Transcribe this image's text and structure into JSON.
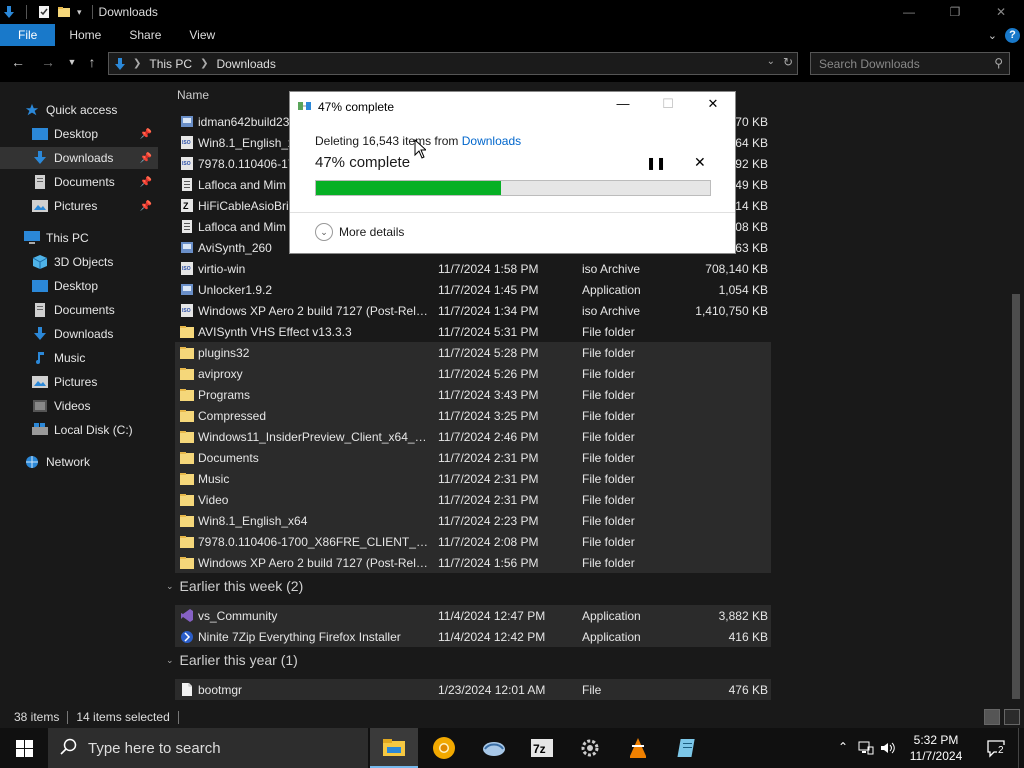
{
  "window": {
    "title": "Downloads",
    "quick_access_icons": [
      "down-arrow-icon",
      "properties-icon",
      "new-folder-icon",
      "customize-dropdown-icon"
    ]
  },
  "ribbon": {
    "tabs": [
      {
        "label": "File",
        "active": true
      },
      {
        "label": "Home"
      },
      {
        "label": "Share"
      },
      {
        "label": "View"
      }
    ],
    "accent": "#1979ca"
  },
  "address": {
    "crumbs": [
      "This PC",
      "Downloads"
    ]
  },
  "search": {
    "placeholder": "Search Downloads"
  },
  "sidebar": {
    "items": [
      {
        "label": "Quick access",
        "icon": "star-icon"
      },
      {
        "label": "Desktop",
        "icon": "desktop-icon",
        "pinned": true
      },
      {
        "label": "Downloads",
        "icon": "download-icon",
        "pinned": true,
        "selected": true
      },
      {
        "label": "Documents",
        "icon": "document-icon",
        "pinned": true
      },
      {
        "label": "Pictures",
        "icon": "pictures-icon",
        "pinned": true
      },
      {
        "label": "This PC",
        "icon": "computer-icon"
      },
      {
        "label": "3D Objects",
        "icon": "cube-icon"
      },
      {
        "label": "Desktop",
        "icon": "desktop-icon"
      },
      {
        "label": "Documents",
        "icon": "document-icon"
      },
      {
        "label": "Downloads",
        "icon": "download-icon"
      },
      {
        "label": "Music",
        "icon": "music-icon"
      },
      {
        "label": "Pictures",
        "icon": "pictures-icon"
      },
      {
        "label": "Videos",
        "icon": "video-icon"
      },
      {
        "label": "Local Disk (C:)",
        "icon": "disk-icon"
      },
      {
        "label": "Network",
        "icon": "network-icon"
      }
    ]
  },
  "list": {
    "column_name": "Name",
    "rows_top": [
      {
        "name": "idman642build23",
        "date": "",
        "type": "",
        "size": "070 KB",
        "icon": "installer-icon"
      },
      {
        "name": "Win8.1_English_x",
        "date": "",
        "type": "",
        "size": "264 KB",
        "icon": "iso-icon"
      },
      {
        "name": "7978.0.110406-17",
        "date": "",
        "type": "",
        "size": "592 KB",
        "icon": "iso-icon"
      },
      {
        "name": "Lafloca and Mim",
        "date": "",
        "type": "",
        "size": "349 KB",
        "icon": "document-icon"
      },
      {
        "name": "HiFiCableAsioBri",
        "date": "",
        "type": "",
        "size": "914 KB",
        "icon": "zip-icon"
      },
      {
        "name": "Lafloca and Mim",
        "date": "",
        "type": "",
        "size": "308 KB",
        "icon": "document-icon"
      },
      {
        "name": "AviSynth_260",
        "date": "",
        "type": "",
        "size": "363 KB",
        "icon": "installer-icon"
      },
      {
        "name": "virtio-win",
        "date": "11/7/2024 1:58 PM",
        "type": "iso Archive",
        "size": "708,140 KB",
        "icon": "iso-icon"
      },
      {
        "name": "Unlocker1.9.2",
        "date": "11/7/2024 1:45 PM",
        "type": "Application",
        "size": "1,054 KB",
        "icon": "installer-icon"
      },
      {
        "name": "Windows XP Aero 2 build 7127 (Post-Rele...",
        "date": "11/7/2024 1:34 PM",
        "type": "iso Archive",
        "size": "1,410,750 KB",
        "icon": "iso-icon"
      },
      {
        "name": "AVISynth VHS Effect v13.3.3",
        "date": "11/7/2024 5:31 PM",
        "type": "File folder",
        "size": "",
        "icon": "folder-icon"
      },
      {
        "name": "plugins32",
        "date": "11/7/2024 5:28 PM",
        "type": "File folder",
        "size": "",
        "icon": "folder-icon",
        "selected": true
      },
      {
        "name": "aviproxy",
        "date": "11/7/2024 5:26 PM",
        "type": "File folder",
        "size": "",
        "icon": "folder-icon",
        "selected": true
      },
      {
        "name": "Programs",
        "date": "11/7/2024 3:43 PM",
        "type": "File folder",
        "size": "",
        "icon": "folder-icon",
        "selected": true
      },
      {
        "name": "Compressed",
        "date": "11/7/2024 3:25 PM",
        "type": "File folder",
        "size": "",
        "icon": "folder-icon",
        "selected": true
      },
      {
        "name": "Windows11_InsiderPreview_Client_x64_e...",
        "date": "11/7/2024 2:46 PM",
        "type": "File folder",
        "size": "",
        "icon": "folder-icon",
        "selected": true
      },
      {
        "name": "Documents",
        "date": "11/7/2024 2:31 PM",
        "type": "File folder",
        "size": "",
        "icon": "folder-icon",
        "selected": true
      },
      {
        "name": "Music",
        "date": "11/7/2024 2:31 PM",
        "type": "File folder",
        "size": "",
        "icon": "folder-icon",
        "selected": true
      },
      {
        "name": "Video",
        "date": "11/7/2024 2:31 PM",
        "type": "File folder",
        "size": "",
        "icon": "folder-icon",
        "selected": true
      },
      {
        "name": "Win8.1_English_x64",
        "date": "11/7/2024 2:23 PM",
        "type": "File folder",
        "size": "",
        "icon": "folder-icon",
        "selected": true
      },
      {
        "name": "7978.0.110406-1700_X86FRE_CLIENT_EN-...",
        "date": "11/7/2024 2:08 PM",
        "type": "File folder",
        "size": "",
        "icon": "folder-icon",
        "selected": true
      },
      {
        "name": "Windows XP Aero 2 build 7127 (Post-Rele...",
        "date": "11/7/2024 1:56 PM",
        "type": "File folder",
        "size": "",
        "icon": "folder-icon",
        "selected": true
      }
    ],
    "group_week": "Earlier this week (2)",
    "rows_week": [
      {
        "name": "vs_Community",
        "date": "11/4/2024 12:47 PM",
        "type": "Application",
        "size": "3,882 KB",
        "icon": "visual-studio-icon",
        "selected": true
      },
      {
        "name": "Ninite 7Zip Everything Firefox Installer",
        "date": "11/4/2024 12:42 PM",
        "type": "Application",
        "size": "416 KB",
        "icon": "ninite-icon",
        "selected": true
      }
    ],
    "group_year": "Earlier this year (1)",
    "rows_year": [
      {
        "name": "bootmgr",
        "date": "1/23/2024 12:01 AM",
        "type": "File",
        "size": "476 KB",
        "icon": "file-icon",
        "selected": true
      }
    ]
  },
  "status": {
    "items_count": "38 items",
    "selected_count": "14 items selected"
  },
  "dialog": {
    "title": "47% complete",
    "desc_prefix": "Deleting 16,543 items from ",
    "desc_link": "Downloads",
    "percent_label": "47% complete",
    "progress": 0.47,
    "more_details": "More details",
    "progress_color": "#06b025"
  },
  "taskbar": {
    "search_placeholder": "Type here to search",
    "apps": [
      "file-explorer-icon",
      "chrome-canary-icon",
      "virtualbox-icon",
      "7zip-icon",
      "settings-gear-icon",
      "vlc-icon",
      "notepad-icon"
    ],
    "time": "5:32 PM",
    "date": "11/7/2024",
    "notification_count": "2"
  }
}
